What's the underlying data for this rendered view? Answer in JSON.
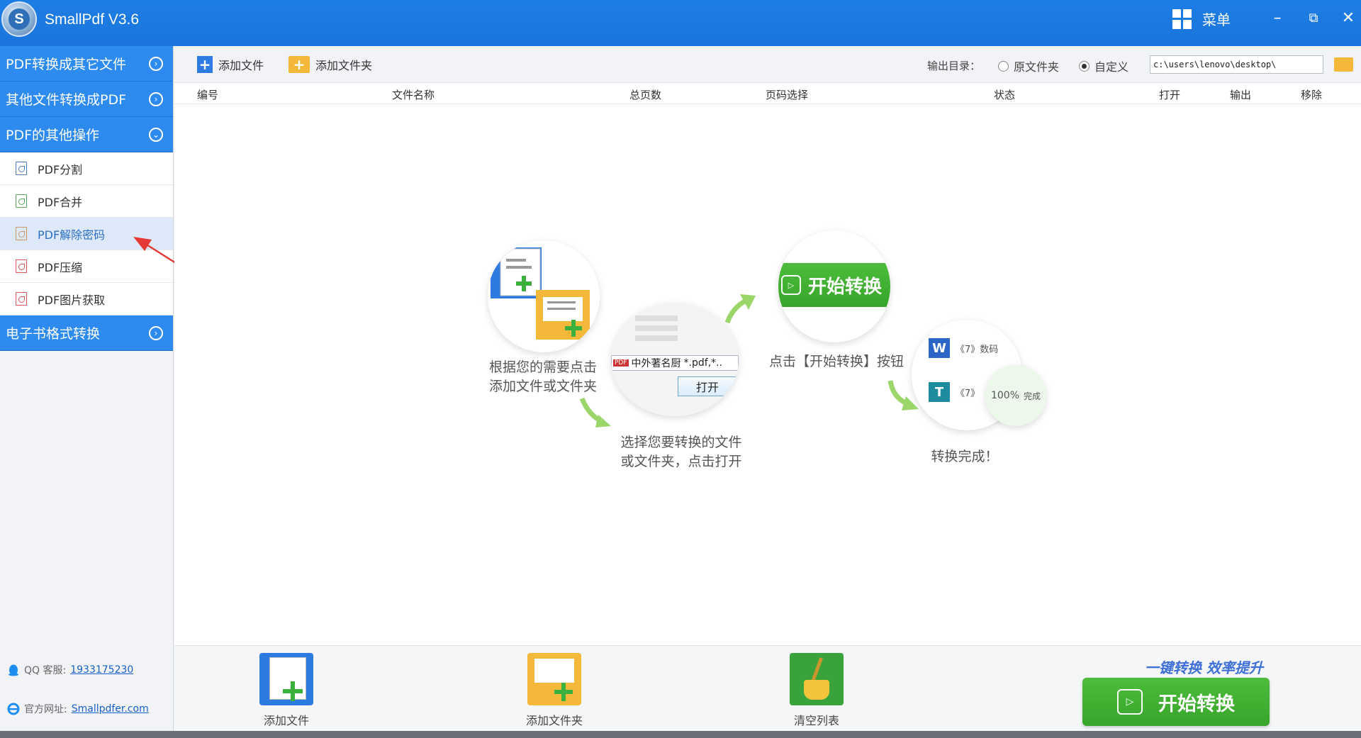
{
  "titlebar": {
    "app_title": "SmallPdf V3.6",
    "logo_letter": "S",
    "menu_label": "菜单",
    "minimize": "–",
    "restore": "⧉",
    "close": "✕"
  },
  "sidebar": {
    "categories": [
      {
        "label": "PDF转换成其它文件",
        "chevron": "›"
      },
      {
        "label": "其他文件转换成PDF",
        "chevron": "›"
      },
      {
        "label": "PDF的其他操作",
        "chevron": "⌄"
      },
      {
        "label": "电子书格式转换",
        "chevron": "›"
      }
    ],
    "items": [
      {
        "label": "PDF分割"
      },
      {
        "label": "PDF合并"
      },
      {
        "label": "PDF解除密码"
      },
      {
        "label": "PDF压缩"
      },
      {
        "label": "PDF图片获取"
      }
    ],
    "footer": {
      "qq_label": "QQ 客服:",
      "qq_number": "1933175230",
      "site_label": "官方网址:",
      "site_url": "Smallpdfer.com"
    }
  },
  "toolbar": {
    "add_file": "添加文件",
    "add_folder": "添加文件夹",
    "output_label": "输出目录：",
    "radio_original": "原文件夹",
    "radio_custom": "自定义",
    "output_path": "c:\\users\\lenovo\\desktop\\"
  },
  "table": {
    "columns": [
      "编号",
      "文件名称",
      "总页数",
      "页码选择",
      "状态",
      "打开",
      "输出",
      "移除"
    ]
  },
  "guide": {
    "step1": "根据您的需要点击\n添加文件或文件夹",
    "step2": "选择您要转换的文件\n或文件夹，点击打开",
    "step2_file_label": "中外著名厨",
    "step2_filter": "*.pdf,*..",
    "step2_open": "打开",
    "step3": "点击【开始转换】按钮",
    "step3_button": "开始转换",
    "step4": "转换完成！",
    "step4_row1": "《7》数码",
    "step4_row2": "《7》",
    "step4_progress": "100%",
    "step4_done": "完成"
  },
  "bottombar": {
    "add_file": "添加文件",
    "add_folder": "添加文件夹",
    "clear_list": "清空列表",
    "slogan": "一键转换  效率提升",
    "start": "开始转换"
  },
  "colors": {
    "titlebar": "#1c7ee5",
    "sidebar_category": "#2d8bef",
    "active_item": "#dde9f9",
    "start_green": "#37a52a",
    "annotation_arrow": "#e53935"
  }
}
